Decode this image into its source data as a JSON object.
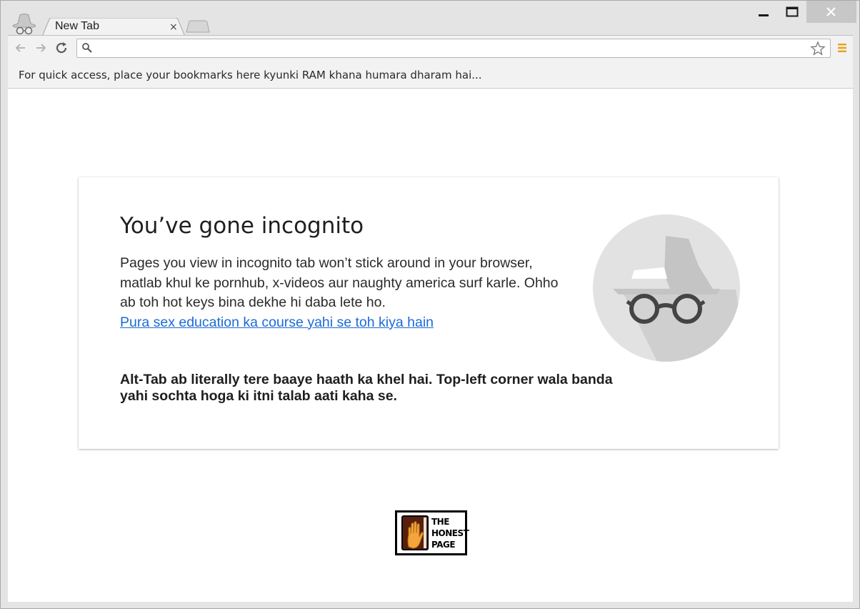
{
  "window": {
    "tab_title": "New Tab",
    "tab_close": "×"
  },
  "bookmarks_bar": {
    "text": "For quick access, place your bookmarks here kyunki RAM khana humara dharam hai..."
  },
  "incognito_card": {
    "heading": "You’ve gone incognito",
    "paragraph": "Pages you view in incognito tab won’t stick around in your browser, matlab khul ke pornhub, x-videos aur naughty america surf karle. Ohho ab toh hot keys bina dekhe hi daba lete ho.",
    "link_text": "Pura sex education ka course yahi se toh kiya hain",
    "bold_note": "Alt-Tab ab literally tere baaye haath ka khel hai. Top-left corner wala banda yahi sochta hoga ki itni talab aati kaha se."
  },
  "logo": {
    "line1": "THE",
    "line2": "HONEST",
    "line3": "PAGE"
  },
  "icons": {
    "incognito_badge": "incognito-spy-icon",
    "back": "back-arrow-icon",
    "forward": "forward-arrow-icon",
    "reload": "reload-icon",
    "search": "search-icon",
    "star": "star-icon",
    "menu": "menu-icon",
    "minimize": "minimize-icon",
    "maximize": "maximize-icon",
    "close": "close-icon"
  },
  "colors": {
    "link": "#1a6bd6",
    "menu_accent": "#e8a21c",
    "close_button": "#c7c7c7"
  }
}
